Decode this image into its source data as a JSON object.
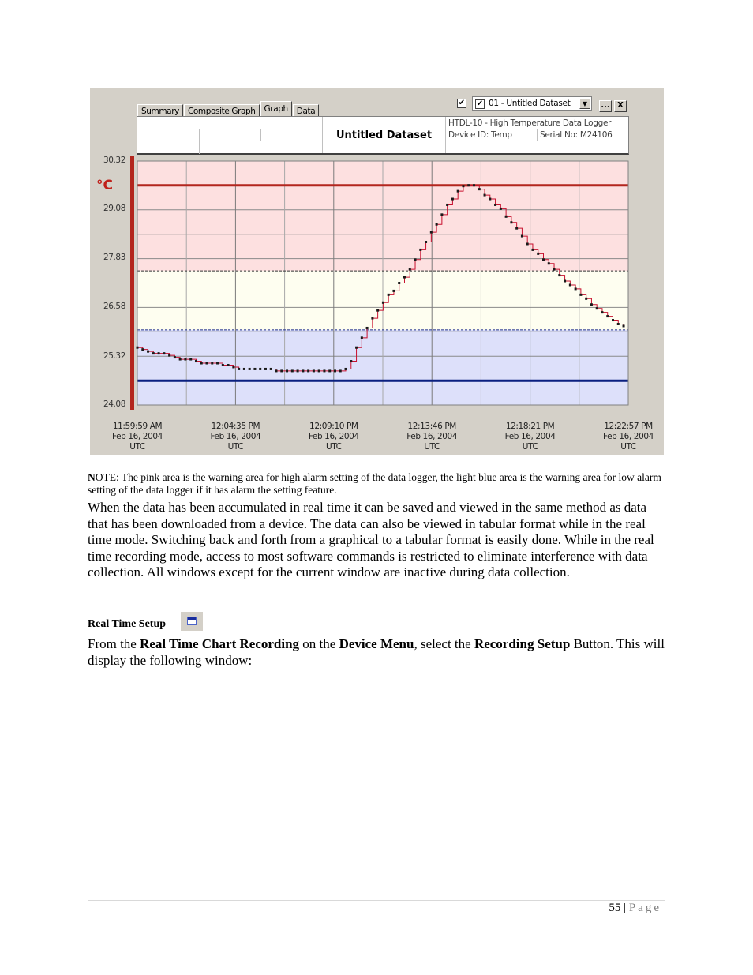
{
  "app": {
    "tabs": [
      {
        "label": "Summary",
        "active": false
      },
      {
        "label": "Composite Graph",
        "active": false
      },
      {
        "label": "Graph",
        "active": true
      },
      {
        "label": "Data",
        "active": false
      }
    ],
    "dataset_select": {
      "value": "01 - Untitled Dataset",
      "checked": true
    },
    "show_checkbox": {
      "checked": true
    },
    "more_button_label": "...",
    "close_button_label": "X",
    "header": {
      "dataset_title": "Untitled Dataset",
      "device_name": "HTDL-10 - High Temperature Data Logger",
      "device_id": "Device ID: Temp",
      "serial_no": "Serial No: M24106"
    }
  },
  "chart_data": {
    "type": "line",
    "title": "Untitled Dataset",
    "ylabel": "°C",
    "xlabel": "",
    "ylim": [
      24.08,
      30.32
    ],
    "y_ticks": [
      "30.32",
      "29.08",
      "27.83",
      "26.58",
      "25.32",
      "24.08"
    ],
    "x_ticks": [
      {
        "time": "11:59:59 AM",
        "date": "Feb 16, 2004",
        "tz": "UTC"
      },
      {
        "time": "12:04:35 PM",
        "date": "Feb 16, 2004",
        "tz": "UTC"
      },
      {
        "time": "12:09:10 PM",
        "date": "Feb 16, 2004",
        "tz": "UTC"
      },
      {
        "time": "12:13:46 PM",
        "date": "Feb 16, 2004",
        "tz": "UTC"
      },
      {
        "time": "12:18:21 PM",
        "date": "Feb 16, 2004",
        "tz": "UTC"
      },
      {
        "time": "12:22:57 PM",
        "date": "Feb 16, 2004",
        "tz": "UTC"
      }
    ],
    "x_unit": "minutes since 11:59:59 AM",
    "xlim": [
      0,
      22.97
    ],
    "grid": true,
    "high_alarm": 29.7,
    "low_alarm": 24.7,
    "high_warning": 27.51,
    "low_warning": 26.0,
    "zone_colors": {
      "high": "#fde0e0",
      "normal": "#fefef0",
      "low": "#dde0fa"
    },
    "line_colors": {
      "high_alarm": "#b3261e",
      "low_alarm": "#0a1f80",
      "series": "#c8102e",
      "marker": "#1a1a1a"
    },
    "series": [
      {
        "name": "Temp",
        "points": [
          [
            0.0,
            25.55
          ],
          [
            0.25,
            25.5
          ],
          [
            0.5,
            25.45
          ],
          [
            0.75,
            25.4
          ],
          [
            1.0,
            25.4
          ],
          [
            1.25,
            25.4
          ],
          [
            1.5,
            25.35
          ],
          [
            1.75,
            25.3
          ],
          [
            2.0,
            25.25
          ],
          [
            2.25,
            25.25
          ],
          [
            2.5,
            25.25
          ],
          [
            2.75,
            25.2
          ],
          [
            3.0,
            25.15
          ],
          [
            3.25,
            25.15
          ],
          [
            3.5,
            25.15
          ],
          [
            3.75,
            25.15
          ],
          [
            4.0,
            25.1
          ],
          [
            4.25,
            25.1
          ],
          [
            4.5,
            25.05
          ],
          [
            4.75,
            25.0
          ],
          [
            5.0,
            25.0
          ],
          [
            5.25,
            25.0
          ],
          [
            5.5,
            25.0
          ],
          [
            5.75,
            25.0
          ],
          [
            6.0,
            25.0
          ],
          [
            6.25,
            25.0
          ],
          [
            6.5,
            24.95
          ],
          [
            6.75,
            24.95
          ],
          [
            7.0,
            24.95
          ],
          [
            7.25,
            24.95
          ],
          [
            7.5,
            24.95
          ],
          [
            7.75,
            24.95
          ],
          [
            8.0,
            24.95
          ],
          [
            8.25,
            24.95
          ],
          [
            8.5,
            24.95
          ],
          [
            8.75,
            24.95
          ],
          [
            9.0,
            24.95
          ],
          [
            9.25,
            24.95
          ],
          [
            9.5,
            24.95
          ],
          [
            9.75,
            25.0
          ],
          [
            10.0,
            25.2
          ],
          [
            10.25,
            25.55
          ],
          [
            10.5,
            25.8
          ],
          [
            10.75,
            26.05
          ],
          [
            11.0,
            26.3
          ],
          [
            11.25,
            26.5
          ],
          [
            11.5,
            26.7
          ],
          [
            11.75,
            26.9
          ],
          [
            12.0,
            27.0
          ],
          [
            12.25,
            27.2
          ],
          [
            12.5,
            27.35
          ],
          [
            12.75,
            27.55
          ],
          [
            13.0,
            27.8
          ],
          [
            13.25,
            28.05
          ],
          [
            13.5,
            28.25
          ],
          [
            13.75,
            28.5
          ],
          [
            14.0,
            28.7
          ],
          [
            14.25,
            28.95
          ],
          [
            14.5,
            29.2
          ],
          [
            14.75,
            29.35
          ],
          [
            15.0,
            29.55
          ],
          [
            15.25,
            29.68
          ],
          [
            15.5,
            29.7
          ],
          [
            15.75,
            29.7
          ],
          [
            16.0,
            29.6
          ],
          [
            16.25,
            29.45
          ],
          [
            16.5,
            29.35
          ],
          [
            16.75,
            29.2
          ],
          [
            17.0,
            29.1
          ],
          [
            17.25,
            28.9
          ],
          [
            17.5,
            28.75
          ],
          [
            17.75,
            28.6
          ],
          [
            18.0,
            28.4
          ],
          [
            18.25,
            28.2
          ],
          [
            18.5,
            28.05
          ],
          [
            18.75,
            27.95
          ],
          [
            19.0,
            27.8
          ],
          [
            19.25,
            27.7
          ],
          [
            19.5,
            27.55
          ],
          [
            19.75,
            27.4
          ],
          [
            20.0,
            27.25
          ],
          [
            20.25,
            27.15
          ],
          [
            20.5,
            27.05
          ],
          [
            20.75,
            26.9
          ],
          [
            21.0,
            26.8
          ],
          [
            21.25,
            26.65
          ],
          [
            21.5,
            26.55
          ],
          [
            21.75,
            26.45
          ],
          [
            22.0,
            26.35
          ],
          [
            22.25,
            26.25
          ],
          [
            22.5,
            26.15
          ],
          [
            22.75,
            26.1
          ]
        ]
      }
    ]
  },
  "document": {
    "note_lead": "N",
    "note_text": "OTE: The pink area is the warning area for high alarm setting of the data logger, the light blue area is the warning area for low alarm setting of the data logger if it has alarm the setting feature.",
    "paragraph1": "When the data has been accumulated in real time it can be saved and viewed in the same method as data that has been downloaded from a device. The data can also be viewed in tabular format while in the real time mode. Switching back and forth from a graphical to a tabular format is easily done. While in the real time recording mode, access to most software commands is restricted to eliminate interference with data collection. All windows except for the current window are inactive during data collection.",
    "setup_heading": "Real Time Setup",
    "p2_a": "From the ",
    "p2_b": "Real Time Chart Recording",
    "p2_c": " on the ",
    "p2_d": "Device Menu",
    "p2_e": ", select the ",
    "p2_f": "Recording Setup",
    "p2_g": " Button. This will display the following window:",
    "page_number": "55",
    "page_sep": " | ",
    "page_word": "Page"
  }
}
